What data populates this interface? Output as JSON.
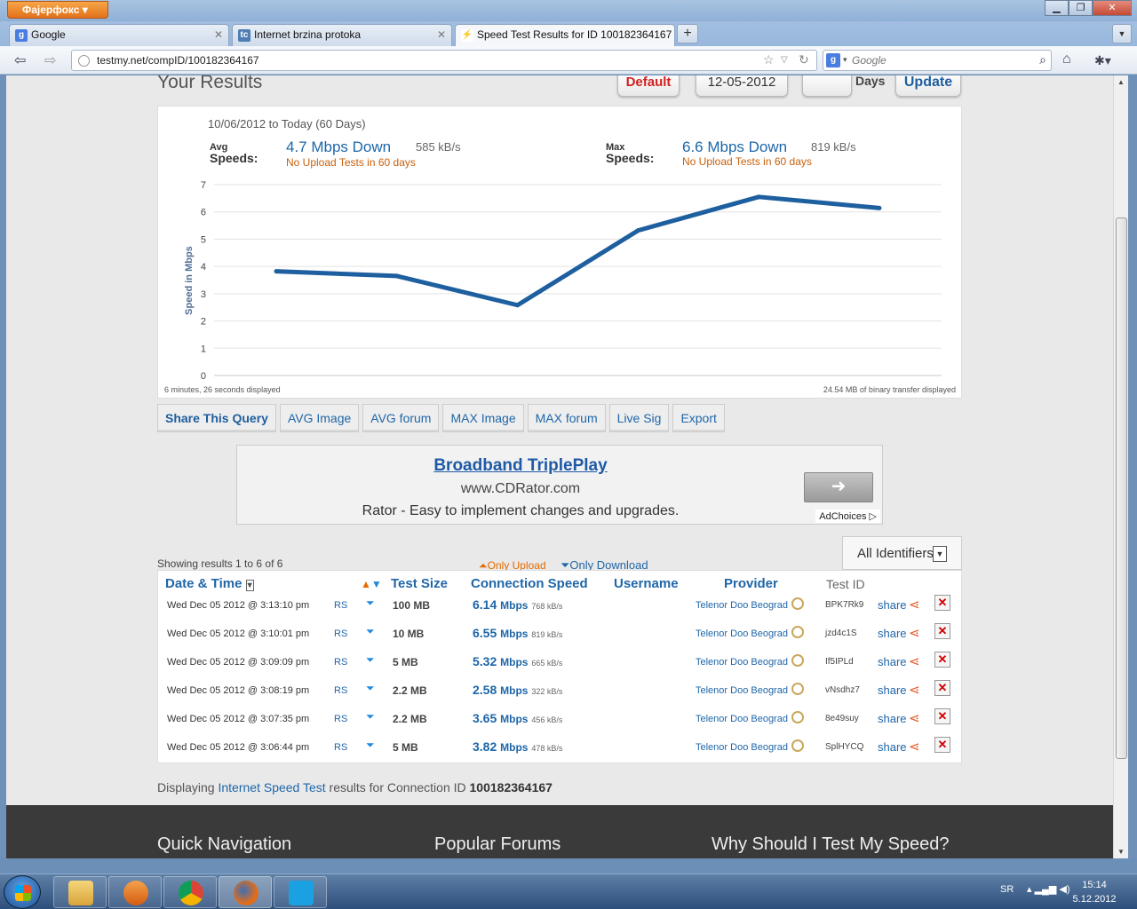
{
  "browser": {
    "menu_button": "Фајерфокс",
    "tabs": [
      {
        "title": "Google"
      },
      {
        "title": "Internet brzina protoka"
      },
      {
        "title": "Speed Test Results for ID 100182364167"
      }
    ],
    "url": "testmy.net/compID/100182364167",
    "search_placeholder": "Google"
  },
  "page": {
    "heading": "Your Results",
    "default_button": "Default",
    "date_value": "12-05-2012",
    "days_value": "",
    "days_label": "Days",
    "update_button": "Update"
  },
  "chart": {
    "date_range": "10/06/2012 to Today (60 Days)",
    "avg_label_1": "Avg",
    "avg_label_2": "Speeds:",
    "avg_speed": "4.7 Mbps Down",
    "avg_kb": "585 kB/s",
    "avg_upload_note": "No Upload Tests in 60 days",
    "max_label_1": "Max",
    "max_label_2": "Speeds:",
    "max_speed": "6.6 Mbps Down",
    "max_kb": "819 kB/s",
    "max_upload_note": "No Upload Tests in 60 days",
    "footer_left": "6 minutes, 26 seconds displayed",
    "footer_right": "24.54 MB of binary transfer displayed"
  },
  "chart_data": {
    "type": "line",
    "ylabel": "Speed in Mbps",
    "xlabel": "",
    "ylim": [
      0,
      7
    ],
    "yticks": [
      0,
      1,
      2,
      3,
      4,
      5,
      6,
      7
    ],
    "grid": true,
    "series": [
      {
        "color": "#1e5f9f",
        "values": [
          3.82,
          3.65,
          2.58,
          5.32,
          6.55,
          6.14
        ]
      }
    ]
  },
  "actions": [
    "Share This Query",
    "AVG Image",
    "AVG forum",
    "MAX Image",
    "MAX forum",
    "Live Sig",
    "Export"
  ],
  "ad": {
    "title": "Broadband TriplePlay",
    "url": "www.CDRator.com",
    "description": "Rator - Easy to implement changes and upgrades.",
    "adchoices": "AdChoices"
  },
  "filters": {
    "identifier_select": "All Identifiers",
    "showing": "Showing results 1 to 6 of 6",
    "only_upload": "Only Upload",
    "only_download": "Only Download"
  },
  "table": {
    "headers": {
      "date_time": "Date & Time",
      "test_size": "Test Size",
      "connection_speed": "Connection Speed",
      "username": "Username",
      "provider": "Provider",
      "test_id": "Test ID"
    },
    "unit_mbps": "Mbps",
    "rows": [
      {
        "date": "Wed Dec 05 2012 @ 3:13:10 pm",
        "country": "RS",
        "size": "100 MB",
        "speed": "6.14",
        "kbs": "768 kB/s",
        "provider": "Telenor Doo Beograd",
        "test_id": "BPK7Rk9",
        "share": "share"
      },
      {
        "date": "Wed Dec 05 2012 @ 3:10:01 pm",
        "country": "RS",
        "size": "10 MB",
        "speed": "6.55",
        "kbs": "819 kB/s",
        "provider": "Telenor Doo Beograd",
        "test_id": "jzd4c1S",
        "share": "share"
      },
      {
        "date": "Wed Dec 05 2012 @ 3:09:09 pm",
        "country": "RS",
        "size": "5 MB",
        "speed": "5.32",
        "kbs": "665 kB/s",
        "provider": "Telenor Doo Beograd",
        "test_id": "If5IPLd",
        "share": "share"
      },
      {
        "date": "Wed Dec 05 2012 @ 3:08:19 pm",
        "country": "RS",
        "size": "2.2 MB",
        "speed": "2.58",
        "kbs": "322 kB/s",
        "provider": "Telenor Doo Beograd",
        "test_id": "vNsdhz7",
        "share": "share"
      },
      {
        "date": "Wed Dec 05 2012 @ 3:07:35 pm",
        "country": "RS",
        "size": "2.2 MB",
        "speed": "3.65",
        "kbs": "456 kB/s",
        "provider": "Telenor Doo Beograd",
        "test_id": "8e49suy",
        "share": "share"
      },
      {
        "date": "Wed Dec 05 2012 @ 3:06:44 pm",
        "country": "RS",
        "size": "5 MB",
        "speed": "3.82",
        "kbs": "478 kB/s",
        "provider": "Telenor Doo Beograd",
        "test_id": "SplHYCQ",
        "share": "share"
      }
    ]
  },
  "displaying": {
    "prefix": "Displaying ",
    "link": "Internet Speed Test",
    "middle": " results for Connection ID ",
    "id": "100182364167"
  },
  "footer": {
    "col1": "Quick Navigation",
    "col2": "Popular Forums",
    "col3": "Why Should I Test My Speed?"
  },
  "taskbar": {
    "language": "SR",
    "time": "15:14",
    "date": "5.12.2012"
  }
}
